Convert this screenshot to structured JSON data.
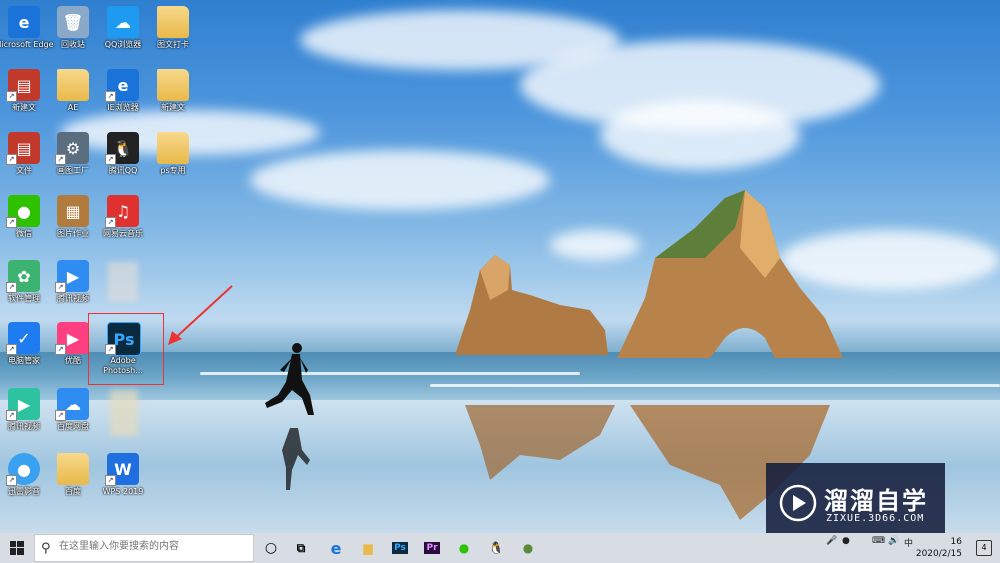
{
  "desktop": {
    "icons": [
      {
        "label": "Microsoft Edge",
        "glyph": "e",
        "color": "#1a73d9"
      },
      {
        "label": "回收站",
        "glyph": "🗑",
        "color": "#8aa8c8"
      },
      {
        "label": "QQ浏览器",
        "glyph": "☁",
        "color": "#1e9bf0"
      },
      {
        "label": "图文打卡",
        "glyph": "",
        "color": "folder"
      },
      {
        "label": "新建文",
        "glyph": "▤",
        "color": "#c0392b"
      },
      {
        "label": "AE",
        "glyph": "",
        "color": "folder"
      },
      {
        "label": "IE浏览器",
        "glyph": "e",
        "color": "#1a73d9"
      },
      {
        "label": "新建文",
        "glyph": "",
        "color": "folder"
      },
      {
        "label": "文件",
        "glyph": "▤",
        "color": "#c0392b"
      },
      {
        "label": "画图工厂",
        "glyph": "⚙",
        "color": "#5b6e80"
      },
      {
        "label": "腾讯QQ",
        "glyph": "🐧",
        "color": "#222222"
      },
      {
        "label": "ps专用",
        "glyph": "",
        "color": "folder"
      },
      {
        "label": "微信",
        "glyph": "●",
        "color": "#2dc100"
      },
      {
        "label": "图片作业",
        "glyph": "▦",
        "color": "#b07b3c"
      },
      {
        "label": "网易云音乐",
        "glyph": "♫",
        "color": "#e03131"
      },
      {
        "label": "软件管理",
        "glyph": "✿",
        "color": "#3cb371"
      },
      {
        "label": "腾讯视频",
        "glyph": "▶",
        "color": "#2f8cf0"
      },
      {
        "label": "优酷",
        "glyph": "▶",
        "color": "#ff3f7f"
      },
      {
        "label": "电脑管家",
        "glyph": "✓",
        "color": "#1e7bf0"
      },
      {
        "label": "Adobe Photosh...",
        "glyph": "Ps",
        "color": "#0b2a3f"
      },
      {
        "label": "腾讯视频",
        "glyph": "▶",
        "color": "#2ec3a0"
      },
      {
        "label": "百度网盘",
        "glyph": "☁",
        "color": "#2f8cf0"
      },
      {
        "label": "迅雷影音",
        "glyph": "●",
        "color": "#3aa0f0"
      },
      {
        "label": "百度",
        "glyph": "",
        "color": "folder"
      },
      {
        "label": "WPS 2019",
        "glyph": "W",
        "color": "#1f6fe0"
      }
    ]
  },
  "watermark": {
    "title": "溜溜自学",
    "subtitle": "ZIXUE.3D66.COM"
  },
  "taskbar": {
    "search_placeholder": "在这里输入你要搜索的内容",
    "pinned": [
      {
        "name": "edge",
        "glyph": "e",
        "color": "#1a73d9"
      },
      {
        "name": "file-explorer",
        "glyph": "▆",
        "color": "#e9b949"
      },
      {
        "name": "photoshop",
        "glyph": "Ps",
        "color": "#0b2a3f"
      },
      {
        "name": "premiere",
        "glyph": "Pr",
        "color": "#2a0a3f"
      },
      {
        "name": "wechat",
        "glyph": "●",
        "color": "#2dc100"
      },
      {
        "name": "qq",
        "glyph": "🐧",
        "color": "#222222"
      },
      {
        "name": "app",
        "glyph": "●",
        "color": "#5a8a3a"
      }
    ],
    "clock_time": "16",
    "clock_date": "2020/2/15",
    "notification_count": "4"
  }
}
